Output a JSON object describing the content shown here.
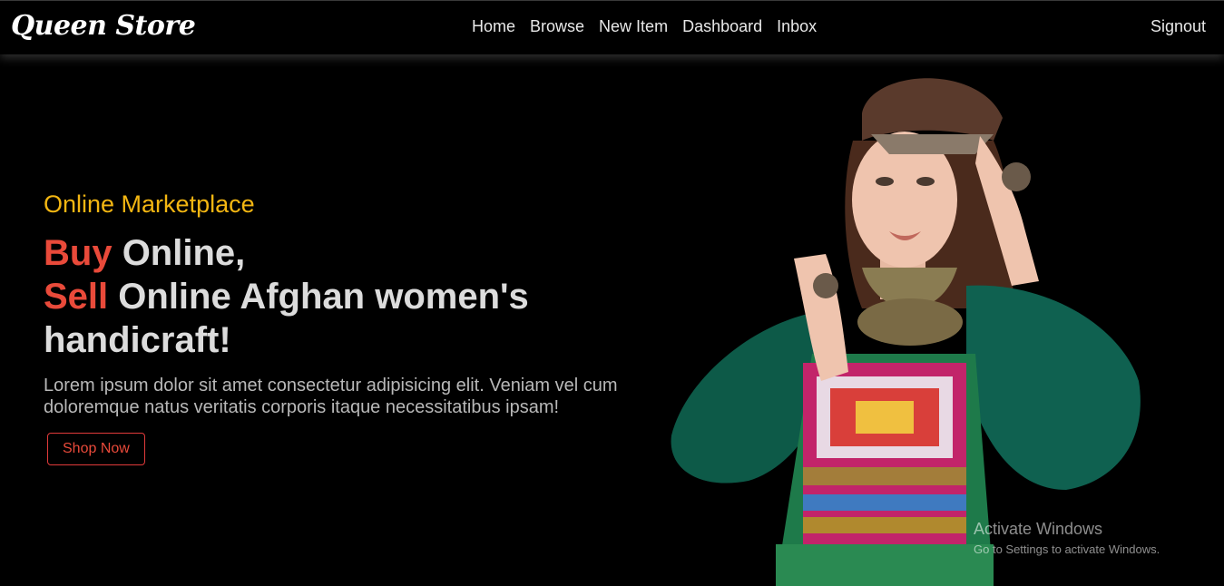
{
  "brand": {
    "name": "Queen Store"
  },
  "nav": {
    "links": [
      "Home",
      "Browse",
      "New Item",
      "Dashboard",
      "Inbox"
    ],
    "signout": "Signout"
  },
  "hero": {
    "tagline": "Online Marketplace",
    "headline": {
      "line1_accent": "Buy",
      "line1_rest": " Online,",
      "line2_accent": "Sell",
      "line2_rest": " Online Afghan women's",
      "line3": "handicraft!"
    },
    "description": "Lorem ipsum dolor sit amet consectetur adipisicing elit. Veniam vel cum doloremque natus veritatis corporis itaque necessitatibus ipsam!",
    "cta_label": "Shop Now"
  },
  "watermark": {
    "title": "Activate Windows",
    "subtitle": "Go to Settings to activate Windows."
  },
  "colors": {
    "accent_red": "#e94a3a",
    "accent_yellow": "#f3b612",
    "background": "#000000"
  }
}
